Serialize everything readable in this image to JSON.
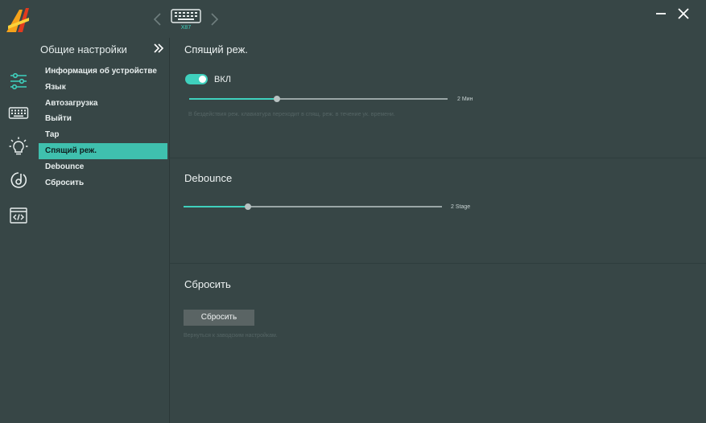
{
  "header": {
    "device_label": "X87"
  },
  "icons": {
    "logo": "app-logo-icon",
    "prev": "chevron-left-icon",
    "next": "chevron-right-icon",
    "device": "keyboard-icon",
    "minimize": "minimize-icon",
    "close": "close-icon",
    "rail": [
      "sliders-icon",
      "keyboard-icon",
      "lightbulb-icon",
      "macro-icon",
      "code-icon"
    ]
  },
  "colors": {
    "accent": "#3fd0bd",
    "background": "#374646"
  },
  "sidebar": {
    "title": "Общие настройки",
    "items": [
      {
        "label": "Информация об устройстве"
      },
      {
        "label": "Язык"
      },
      {
        "label": "Автозагрузка"
      },
      {
        "label": "Выйти"
      },
      {
        "label": "Тар"
      },
      {
        "label": "Спящий реж."
      },
      {
        "label": "Debounce"
      },
      {
        "label": "Сбросить"
      }
    ],
    "active_index": 5
  },
  "sleep": {
    "title": "Спящий реж.",
    "toggle_label": "ВКЛ",
    "toggle_on": true,
    "slider_value": "2 Мин",
    "slider_fraction": 0.34,
    "hint": "В бездействия реж. клавиатура переходит в спящ. реж. в течение ук. времени."
  },
  "debounce": {
    "title": "Debounce",
    "slider_value": "2 Stage",
    "slider_fraction": 0.25
  },
  "reset": {
    "title": "Сбросить",
    "button_label": "Сбросить",
    "hint": "Вернуться к заводским настройкам."
  }
}
